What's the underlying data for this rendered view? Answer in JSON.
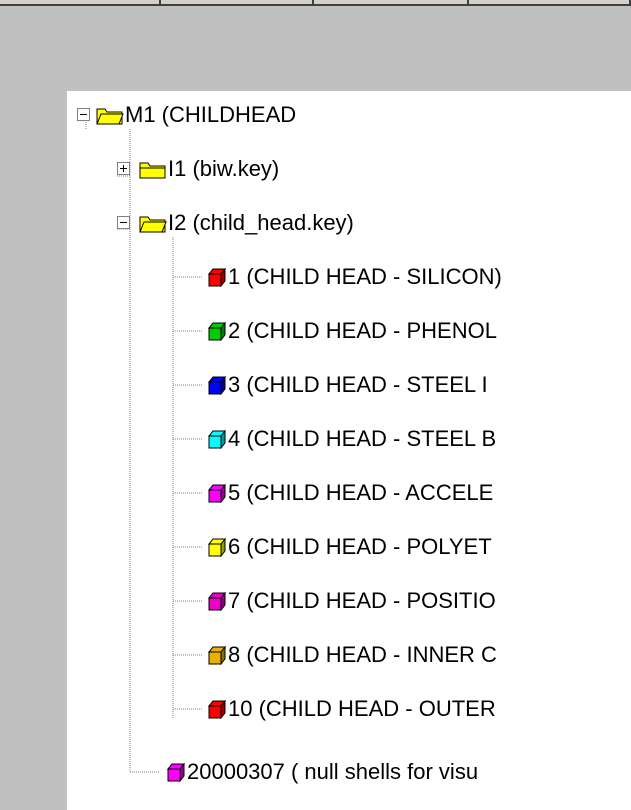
{
  "colors": {
    "panel_bg": "#c0c0c0",
    "tree_bg": "#ffffff",
    "folder": "#ffff00",
    "line": "#808080"
  },
  "tree": {
    "root": {
      "label": "M1 (CHILDHEAD",
      "icon": "folder-open-icon",
      "expanded": true
    },
    "includes": [
      {
        "label": "I1 (biw.key)",
        "icon": "folder-icon",
        "expanded": false
      },
      {
        "label": "I2 (child_head.key)",
        "icon": "folder-open-icon",
        "expanded": true
      }
    ],
    "parts": [
      {
        "label": "1 (CHILD HEAD - SILICON)",
        "icon": "part-cube-icon",
        "color": "#ff0000"
      },
      {
        "label": "2 (CHILD HEAD - PHENOL",
        "icon": "part-cube-icon",
        "color": "#00cc00"
      },
      {
        "label": "3 (CHILD HEAD - STEEL I",
        "icon": "part-cube-icon",
        "color": "#0000ff"
      },
      {
        "label": "4 (CHILD HEAD - STEEL B",
        "icon": "part-cube-icon",
        "color": "#00ffff"
      },
      {
        "label": "5 (CHILD HEAD - ACCELE",
        "icon": "part-cube-icon",
        "color": "#ff00ff"
      },
      {
        "label": "6 (CHILD HEAD - POLYET",
        "icon": "part-cube-icon",
        "color": "#ffff00"
      },
      {
        "label": "7 (CHILD HEAD - POSITIO",
        "icon": "part-cube-icon",
        "color": "#ee00cc"
      },
      {
        "label": "8 (CHILD HEAD - INNER C",
        "icon": "part-cube-icon",
        "color": "#e8b000"
      },
      {
        "label": "10 (CHILD HEAD - OUTER",
        "icon": "part-cube-icon",
        "color": "#ff0000"
      }
    ],
    "trailing": {
      "label": "20000307 ( null shells for visu",
      "icon": "part-cube-icon",
      "color": "#ff00ff"
    }
  }
}
